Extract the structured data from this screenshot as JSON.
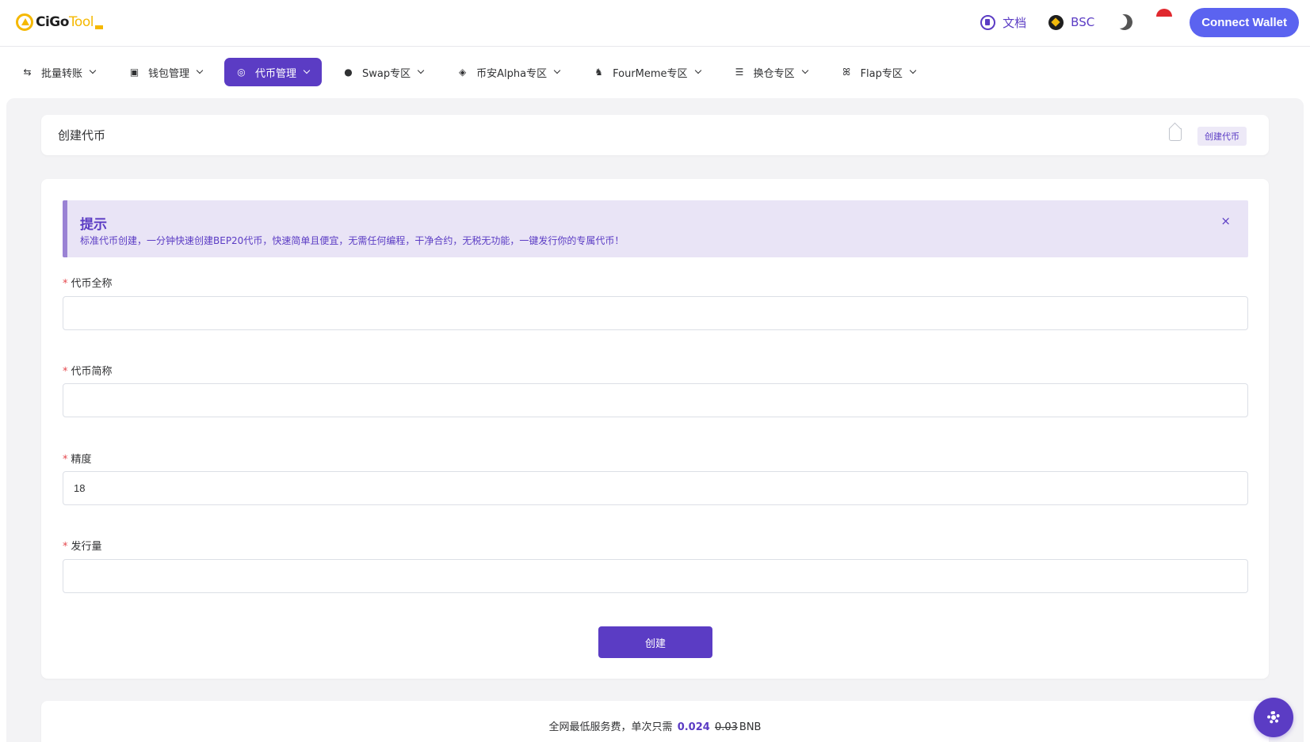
{
  "header": {
    "logo_text_a": "CiGo",
    "logo_text_b": "Tool",
    "docs_label": "文档",
    "chain_label": "BSC",
    "connect_label": "Connect Wallet"
  },
  "nav": {
    "items": [
      {
        "label": "批量转账",
        "icon": "batch-transfer-icon"
      },
      {
        "label": "钱包管理",
        "icon": "wallet-icon"
      },
      {
        "label": "代币管理",
        "icon": "token-icon",
        "active": true
      },
      {
        "label": "Swap专区",
        "icon": "bunny-icon"
      },
      {
        "label": "币安Alpha专区",
        "icon": "binance-icon"
      },
      {
        "label": "FourMeme专区",
        "icon": "fourmeme-icon"
      },
      {
        "label": "换仓专区",
        "icon": "coins-icon"
      },
      {
        "label": "Flap专区",
        "icon": "butterfly-icon"
      }
    ]
  },
  "page": {
    "title": "创建代币",
    "breadcrumb": "创建代币"
  },
  "tip": {
    "title": "提示",
    "desc": "标准代币创建，一分钟快速创建BEP20代币，快速简单且便宜，无需任何编程，干净合约，无税无功能，一键发行你的专属代币！",
    "close": "×"
  },
  "form": {
    "required_mark": "*",
    "name_label": "代币全称",
    "name_value": "",
    "symbol_label": "代币简称",
    "symbol_value": "",
    "decimals_label": "精度",
    "decimals_value": "18",
    "supply_label": "发行量",
    "supply_value": "",
    "submit_label": "创建"
  },
  "footer": {
    "fee_prefix": "全网最低服务费，单次只需",
    "fee_price": "0.024",
    "fee_old": "0.03",
    "fee_unit": "BNB"
  },
  "colors": {
    "primary": "#5b3cc4",
    "connect": "#5b63f0",
    "accent_yellow": "#f5b800",
    "required": "#e5484d"
  }
}
